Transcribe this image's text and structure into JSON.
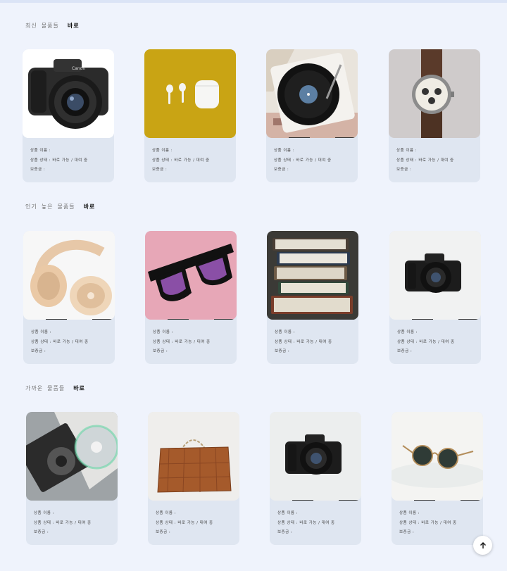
{
  "sections": [
    {
      "title_words": [
        "최신",
        "물품들"
      ],
      "accent": "바로",
      "products": [
        {
          "icon": "camera-icon",
          "name_label": "상품 이름 :",
          "status_label": "상품 상태 :",
          "status_value": "바로 가능 / 대여 중",
          "deposit_label": "보증금 :"
        },
        {
          "icon": "earbuds-icon",
          "name_label": "상품 이름 :",
          "status_label": "상품 상태 :",
          "status_value": "바로 가능 / 대여 중",
          "deposit_label": "보증금 :"
        },
        {
          "icon": "record-player-icon",
          "name_label": "상품 이름 :",
          "status_label": "상품 상태 :",
          "status_value": "바로 가능 / 대여 중",
          "deposit_label": "보증금 :"
        },
        {
          "icon": "watch-icon",
          "name_label": "상품 이름 :",
          "status_label": "상품 상태 :",
          "status_value": "바로 가능 / 대여 중",
          "deposit_label": "보증금 :"
        }
      ]
    },
    {
      "title_words": [
        "인기",
        "높은",
        "물품들"
      ],
      "accent": "바로",
      "products": [
        {
          "icon": "headphones-icon",
          "name_label": "상품 이름 :",
          "status_label": "상품 상태 :",
          "status_value": "바로 가능 / 대여 중",
          "deposit_label": "보증금 :"
        },
        {
          "icon": "sunglasses-icon",
          "name_label": "상품 이름 :",
          "status_label": "상품 상태 :",
          "status_value": "바로 가능 / 대여 중",
          "deposit_label": "보증금 :"
        },
        {
          "icon": "books-icon",
          "name_label": "상품 이름 :",
          "status_label": "상품 상태 :",
          "status_value": "바로 가능 / 대여 중",
          "deposit_label": "보증금 :"
        },
        {
          "icon": "camera-icon",
          "name_label": "상품 이름 :",
          "status_label": "상품 상태 :",
          "status_value": "바로 가능 / 대여 중",
          "deposit_label": "보증금 :"
        }
      ]
    },
    {
      "title_words": [
        "가까운",
        "물품들"
      ],
      "accent": "바로",
      "products": [
        {
          "icon": "disc-drive-icon",
          "name_label": "상품 이름 :",
          "status_label": "상품 상태 :",
          "status_value": "바로 가능 / 대여 중",
          "deposit_label": "보증금 :"
        },
        {
          "icon": "handbag-icon",
          "name_label": "상품 이름 :",
          "status_label": "상품 상태 :",
          "status_value": "바로 가능 / 대여 중",
          "deposit_label": "보증금 :"
        },
        {
          "icon": "camera-icon",
          "name_label": "상품 이름 :",
          "status_label": "상품 상태 :",
          "status_value": "바로 가능 / 대여 중",
          "deposit_label": "보증금 :"
        },
        {
          "icon": "round-sunglasses-icon",
          "name_label": "상품 이름 :",
          "status_label": "상품 상태 :",
          "status_value": "바로 가능 / 대여 중",
          "deposit_label": "보증금 :"
        }
      ]
    }
  ],
  "scroll_top": {
    "icon": "arrow-up-icon"
  }
}
